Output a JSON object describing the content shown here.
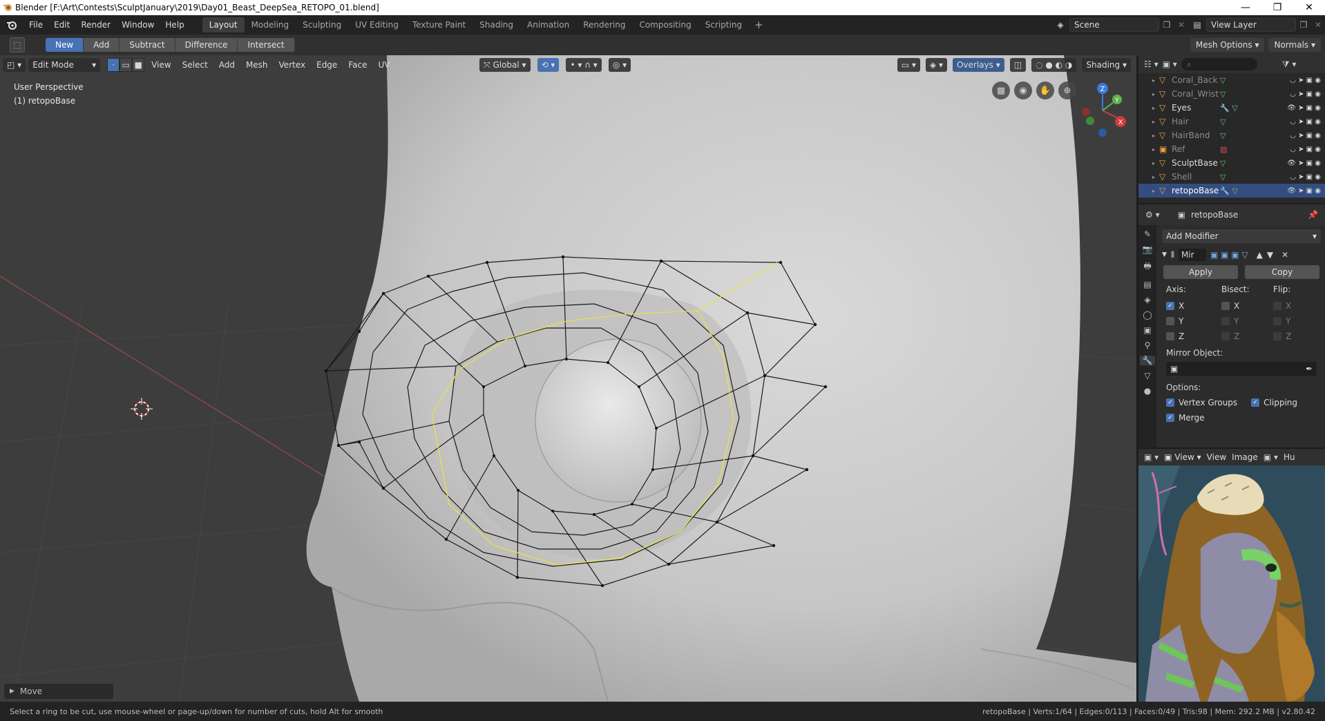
{
  "window": {
    "title": "Blender [F:\\Art\\Contests\\SculptJanuary\\2019\\Day01_Beast_DeepSea_RETOPO_01.blend]",
    "controls": [
      "—",
      "❐",
      "✕"
    ]
  },
  "menubar": {
    "menus": [
      "File",
      "Edit",
      "Render",
      "Window",
      "Help"
    ],
    "workspaces": [
      "Layout",
      "Modeling",
      "Sculpting",
      "UV Editing",
      "Texture Paint",
      "Shading",
      "Animation",
      "Rendering",
      "Compositing",
      "Scripting"
    ],
    "active_workspace": "Layout",
    "add_workspace": "+",
    "scene": "Scene",
    "view_layer": "View Layer"
  },
  "toolheader": {
    "boolean_modes": [
      "New",
      "Add",
      "Subtract",
      "Difference",
      "Intersect"
    ],
    "active_mode": "New",
    "mesh_options": "Mesh Options",
    "normals": "Normals"
  },
  "viewport": {
    "mode": "Edit Mode",
    "menus": [
      "View",
      "Select",
      "Add",
      "Mesh",
      "Vertex",
      "Edge",
      "Face",
      "UV"
    ],
    "orientation": "Global",
    "overlays": "Overlays",
    "shading": "Shading",
    "info_line1": "User Perspective",
    "info_line2": "(1) retopoBase",
    "last_operator": "Move",
    "gizmo_axes": [
      "Z",
      "Y",
      "X"
    ]
  },
  "outliner": {
    "rows": [
      {
        "name": "Coral_Back",
        "visible": false,
        "selected": false
      },
      {
        "name": "Coral_Wrist",
        "visible": false,
        "selected": false
      },
      {
        "name": "Eyes",
        "visible": true,
        "selected": false
      },
      {
        "name": "Hair",
        "visible": false,
        "selected": false
      },
      {
        "name": "HairBand",
        "visible": false,
        "selected": false
      },
      {
        "name": "Ref",
        "visible": false,
        "selected": false
      },
      {
        "name": "SculptBase",
        "visible": true,
        "selected": false
      },
      {
        "name": "Shell",
        "visible": false,
        "selected": false
      },
      {
        "name": "retopoBase",
        "visible": true,
        "selected": true
      }
    ]
  },
  "properties": {
    "object_name": "retopoBase",
    "add_modifier": "Add Modifier",
    "modifier_name": "Mir",
    "apply": "Apply",
    "copy": "Copy",
    "axis_label": "Axis:",
    "bisect_label": "Bisect:",
    "flip_label": "Flip:",
    "axis": [
      {
        "label": "X",
        "axis": true,
        "bisect": false,
        "flip": false
      },
      {
        "label": "Y",
        "axis": false,
        "bisect": false,
        "flip": false
      },
      {
        "label": "Z",
        "axis": false,
        "bisect": false,
        "flip": false
      }
    ],
    "mirror_object_label": "Mirror Object:",
    "options_label": "Options:",
    "vertex_groups": "Vertex Groups",
    "clipping": "Clipping",
    "merge": "Merge"
  },
  "image_editor": {
    "menus": [
      "View",
      "View",
      "Image"
    ],
    "overflow_label": "Hu"
  },
  "statusbar": {
    "hint": "Select a ring to be cut, use mouse-wheel or page-up/down for number of cuts, hold Alt for smooth",
    "stats": "retopoBase | Verts:1/64 | Edges:0/113 | Faces:0/49 | Tris:98 | Mem: 292.2 MB | v2.80.42"
  },
  "colors": {
    "accent": "#4772b3",
    "object_orange": "#f2a33a",
    "selected_row": "#334d80",
    "viewport_bg": "#3d3d3d",
    "mesh_wire": "#1a1a1a",
    "loop_highlight": "#e8e04a"
  }
}
